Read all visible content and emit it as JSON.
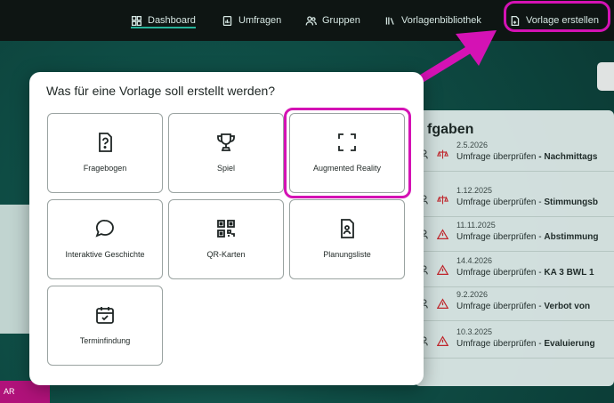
{
  "nav": {
    "dashboard": "Dashboard",
    "umfragen": "Umfragen",
    "gruppen": "Gruppen",
    "vorlagenbibliothek": "Vorlagenbibliothek",
    "vorlage_erstellen": "Vorlage erstellen"
  },
  "modal": {
    "title": "Was für eine Vorlage soll erstellt werden?",
    "cards": [
      {
        "label": "Fragebogen",
        "icon": "document-question-icon"
      },
      {
        "label": "Spiel",
        "icon": "trophy-icon"
      },
      {
        "label": "Augmented Reality",
        "icon": "scan-frame-icon"
      },
      {
        "label": "Interaktive Geschichte",
        "icon": "speech-bubble-icon"
      },
      {
        "label": "QR-Karten",
        "icon": "qr-code-icon"
      },
      {
        "label": "Planungsliste",
        "icon": "document-person-icon"
      },
      {
        "label": "Terminfindung",
        "icon": "calendar-check-icon"
      }
    ]
  },
  "tasks": {
    "title_fragment": "fgaben",
    "rows": [
      {
        "date": "2.5.2026",
        "text": "Umfrage überprüfen",
        "suffix": "- Nachmittags"
      },
      {
        "date": "1.12.2025",
        "text": "Umfrage überprüfen -",
        "suffix": "Stimmungsb"
      },
      {
        "date": "11.11.2025",
        "text": "Umfrage überprüfen -",
        "suffix": "Abstimmung"
      },
      {
        "date": "14.4.2026",
        "text": "Umfrage überprüfen -",
        "suffix": "KA 3 BWL 1"
      },
      {
        "date": "9.2.2026",
        "text": "Umfrage überprüfen -",
        "suffix": "Verbot von"
      },
      {
        "date": "10.3.2025",
        "text": "Umfrage überprüfen -",
        "suffix": "Evaluierung"
      }
    ]
  },
  "badge": "AR",
  "colors": {
    "highlight": "#d412b4",
    "accent": "#27b39a",
    "topbar": "#0e1513"
  }
}
